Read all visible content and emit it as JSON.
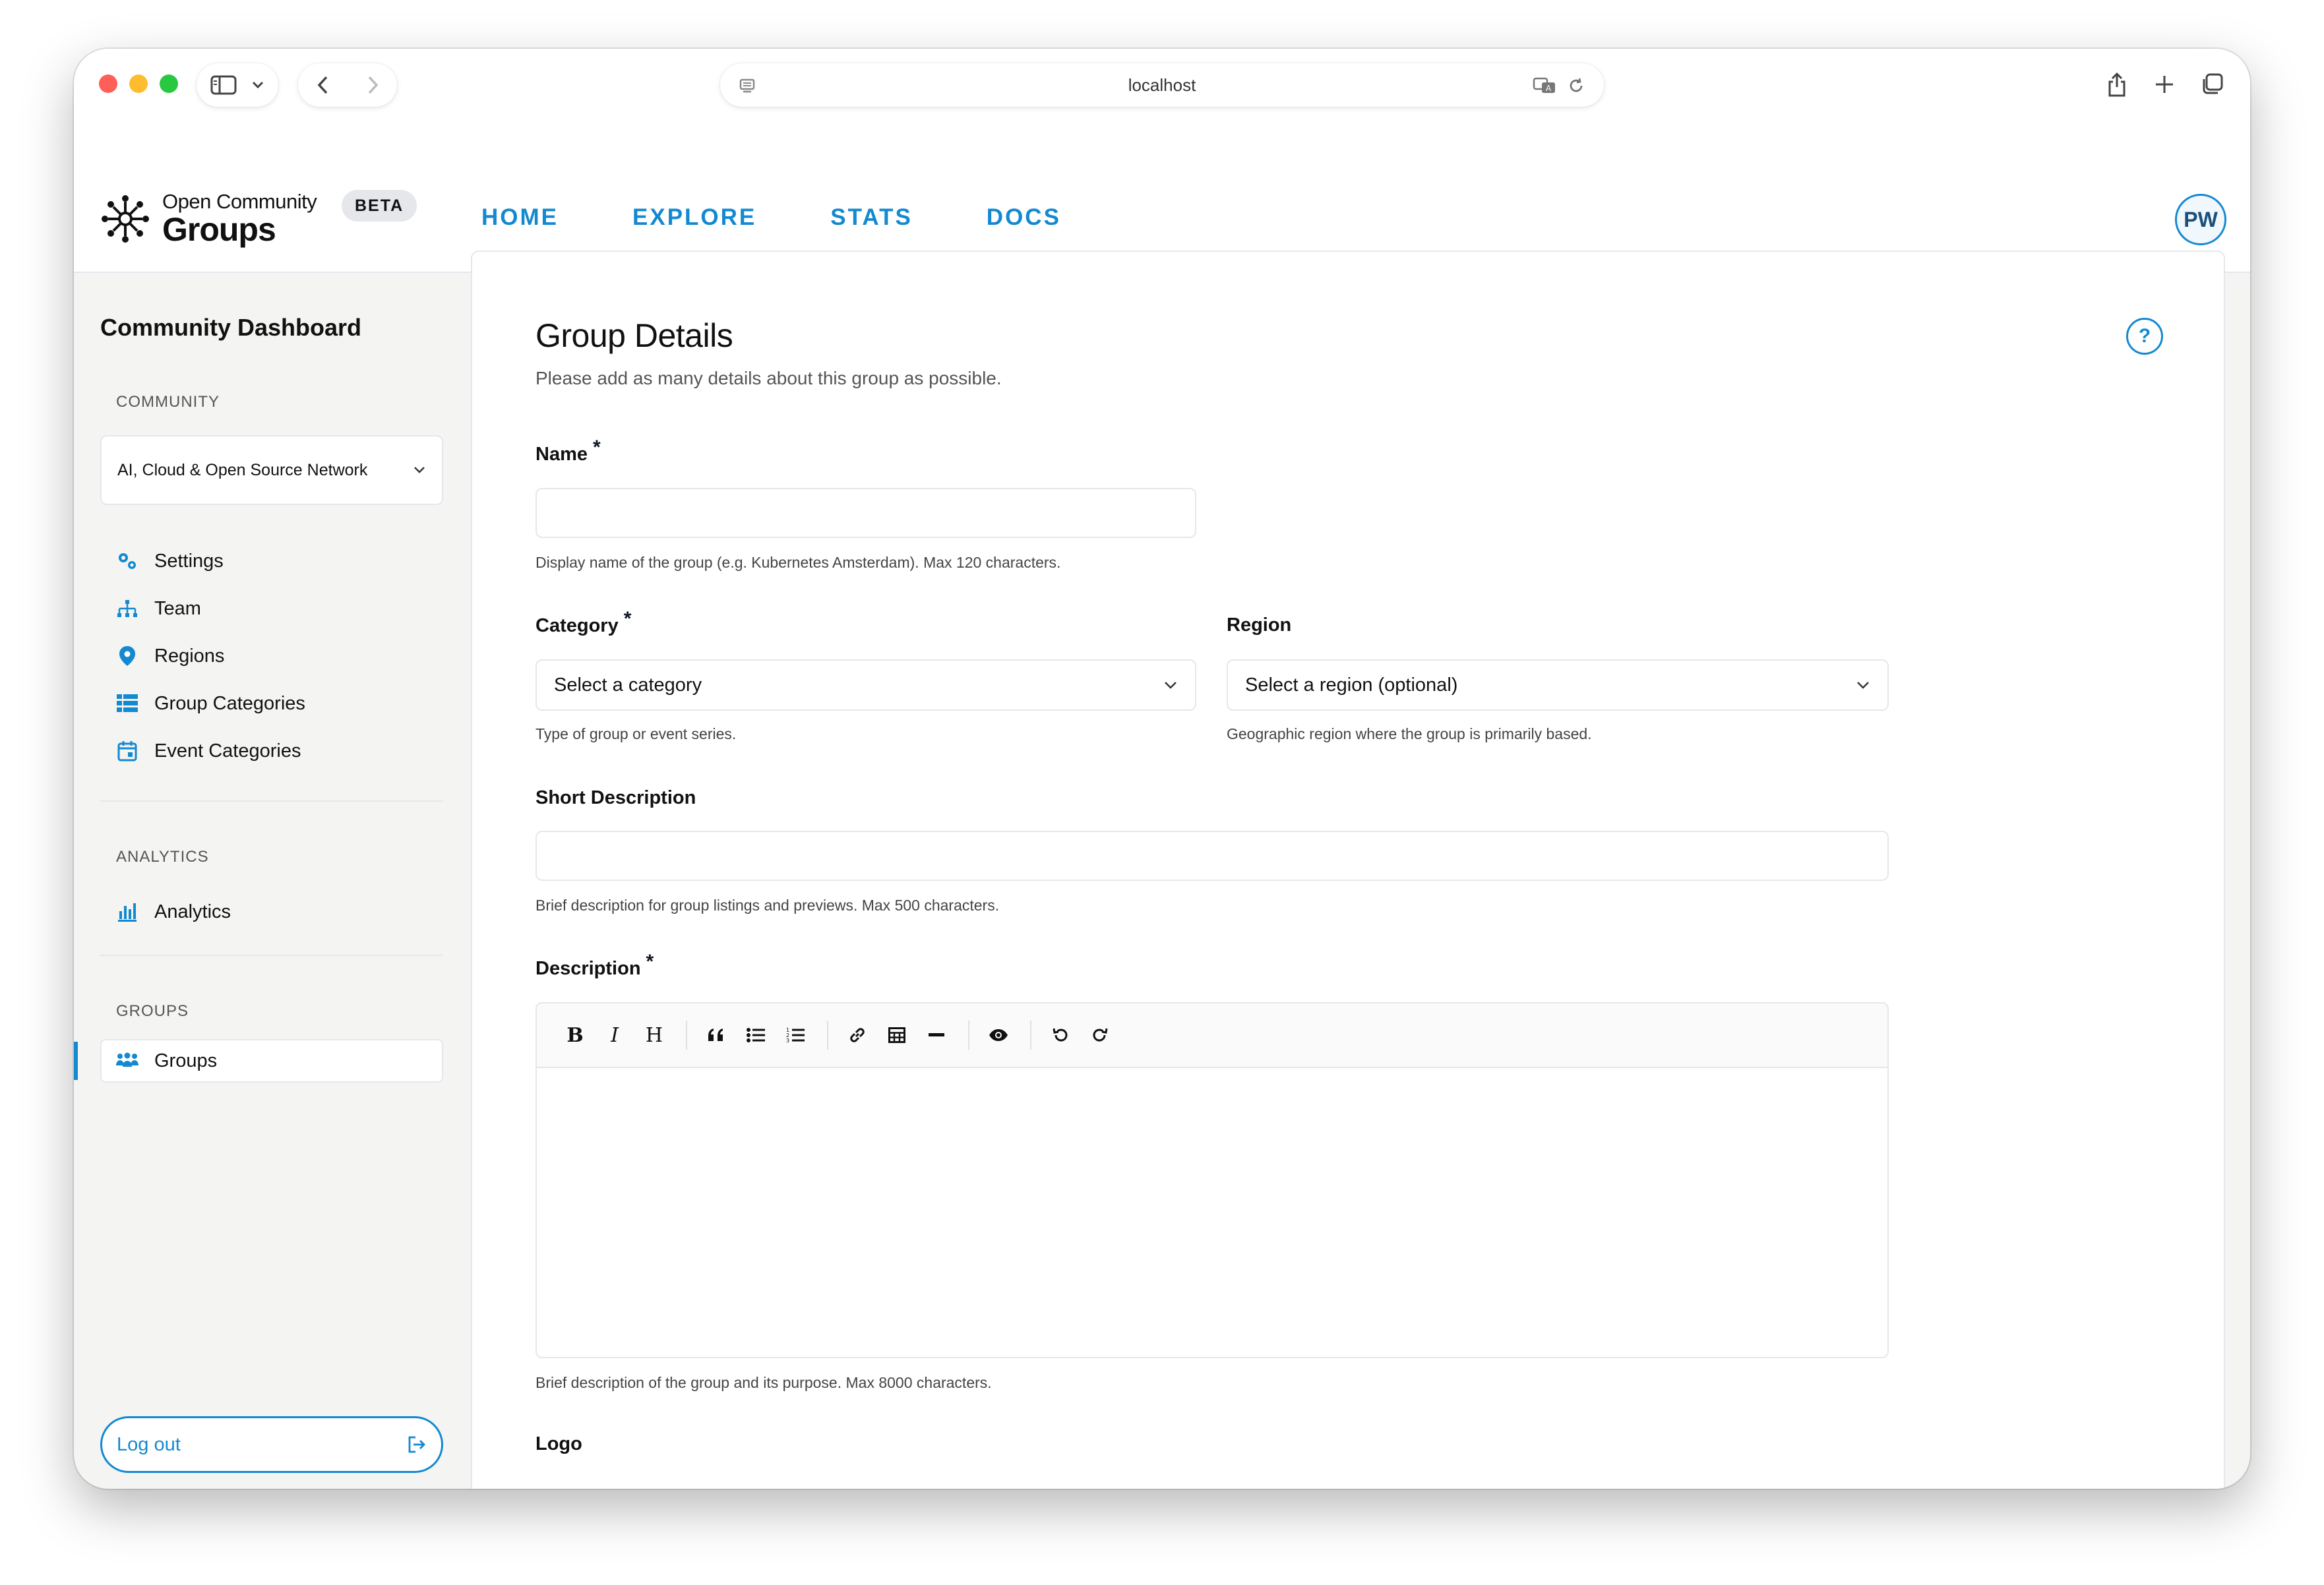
{
  "browser": {
    "address": "localhost"
  },
  "header": {
    "logo_top": "Open Community",
    "logo_bottom": "Groups",
    "beta": "BETA",
    "nav": [
      "HOME",
      "EXPLORE",
      "STATS",
      "DOCS"
    ],
    "avatar_initials": "PW"
  },
  "sidebar": {
    "title": "Community Dashboard",
    "community_section": "COMMUNITY",
    "community_selected": "AI, Cloud & Open Source Network",
    "items": [
      "Settings",
      "Team",
      "Regions",
      "Group Categories",
      "Event Categories"
    ],
    "analytics_section": "ANALYTICS",
    "analytics_item": "Analytics",
    "groups_section": "GROUPS",
    "groups_item": "Groups",
    "logout": "Log out"
  },
  "form": {
    "title": "Group Details",
    "subtitle": "Please add as many details about this group as possible.",
    "name_label": "Name",
    "name_help": "Display name of the group (e.g. Kubernetes Amsterdam). Max 120 characters.",
    "category_label": "Category",
    "category_value": "Select a category",
    "category_help": "Type of group or event series.",
    "region_label": "Region",
    "region_value": "Select a region (optional)",
    "region_help": "Geographic region where the group is primarily based.",
    "short_desc_label": "Short Description",
    "short_desc_help": "Brief description for group listings and previews. Max 500 characters.",
    "desc_label": "Description",
    "desc_help": "Brief description of the group and its purpose. Max 8000 characters.",
    "logo_label": "Logo",
    "required_mark": "*"
  },
  "colors": {
    "accent": "#1389d1"
  }
}
